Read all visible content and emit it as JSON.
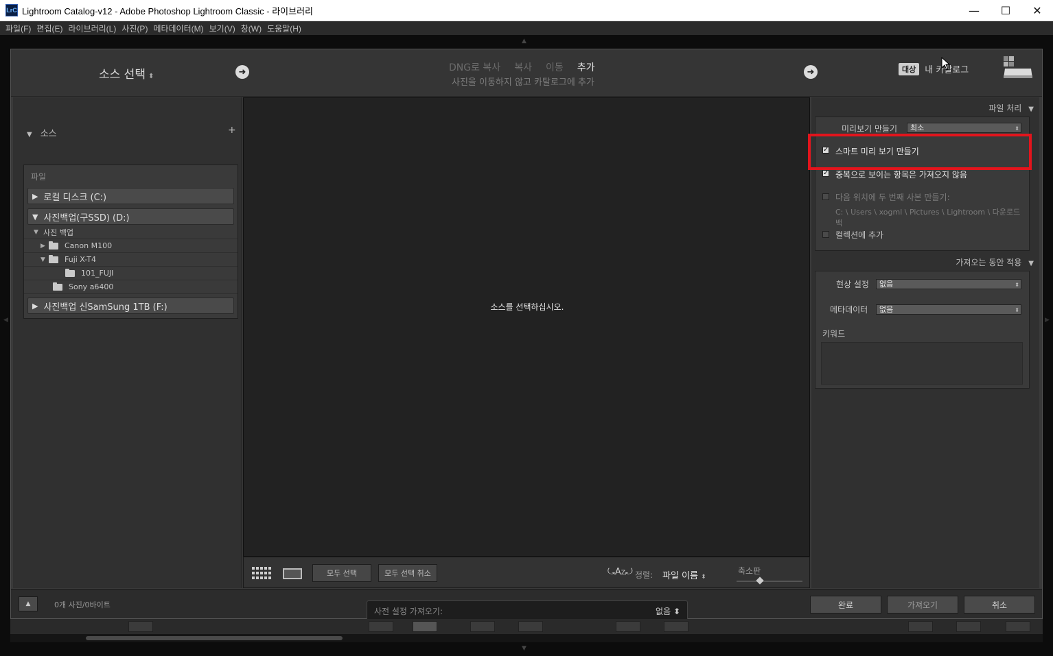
{
  "window": {
    "app_icon": "LrC",
    "title": "Lightroom Catalog-v12 - Adobe Photoshop Lightroom Classic - 라이브러리",
    "minimize": "—",
    "maximize": "☐",
    "close": "✕"
  },
  "menu": [
    "파일(F)",
    "편집(E)",
    "라이브러리(L)",
    "사진(P)",
    "메타데이터(M)",
    "보기(V)",
    "창(W)",
    "도움말(H)"
  ],
  "header": {
    "source_select": "소스 선택",
    "modes": [
      {
        "label": "DNG로 복사",
        "active": false
      },
      {
        "label": "복사",
        "active": false
      },
      {
        "label": "이동",
        "active": false
      },
      {
        "label": "추가",
        "active": true
      }
    ],
    "mode_subtitle": "사진을 이동하지 않고 카탈로그에 추가",
    "dest_badge": "대상",
    "dest_label": "내 카탈로그"
  },
  "left_panel": {
    "title": "소스",
    "add_label": "+",
    "file_label": "파일",
    "drives": [
      {
        "label": "로컬 디스크 (C:)",
        "tri": "▶"
      },
      {
        "label": "사진백업(구SSD) (D:)",
        "tri": "▼"
      },
      {
        "label": "사진백업 신SamSung 1TB (F:)",
        "tri": "▶"
      }
    ],
    "folders": [
      {
        "label": "사진 백업"
      },
      {
        "label": "Canon M100"
      },
      {
        "label": "Fuji X-T4"
      },
      {
        "label": "101_FUJI"
      },
      {
        "label": "Sony a6400"
      }
    ]
  },
  "center": {
    "message": "소스를 선택하십시오.",
    "select_all": "모두 선택",
    "deselect_all": "모두 선택 취소",
    "sort_label": "정렬:",
    "sort_value": "파일 이름",
    "thumb_label": "축소판"
  },
  "right_panel": {
    "file_handling": "파일 처리",
    "preview_label": "미리보기 만들기",
    "preview_value": "최소",
    "smart_preview": "스마트 미리 보기 만들기",
    "no_duplicates": "중복으로 보이는 항목은 가져오지 않음",
    "second_copy": "다음 위치에 두 번째 사본 만들기:",
    "second_copy_path": "C: \\ Users \\ xogml \\ Pictures \\ Lightroom \\ 다운로드 백",
    "add_collection": "컬렉션에 추가",
    "apply_during": "가져오는 동안 적용",
    "develop_label": "현상 설정",
    "develop_value": "없음",
    "metadata_label": "메타데이터",
    "metadata_value": "없음",
    "keywords_label": "키워드"
  },
  "footer": {
    "count": "0개 사진/0바이트",
    "preset_label": "사전 설정 가져오기:",
    "preset_value": "없음",
    "done": "완료",
    "import": "가져오기",
    "cancel": "취소"
  }
}
